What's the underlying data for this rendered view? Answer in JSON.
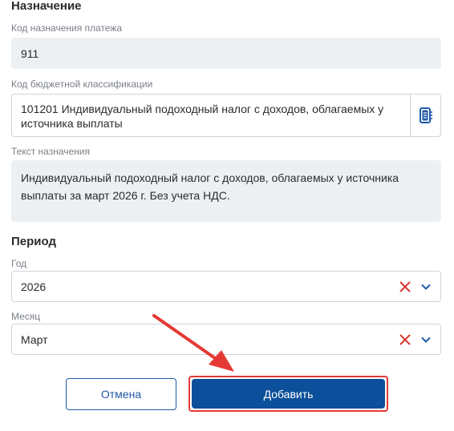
{
  "purpose_section": {
    "title": "Назначение",
    "payment_code": {
      "label": "Код назначения платежа",
      "value": "911"
    },
    "budget_code": {
      "label": "Код бюджетной классификации",
      "value": "101201 Индивидуальный подоходный налог с доходов, облагаемых у источника выплаты"
    },
    "purpose_text": {
      "label": "Текст назначения",
      "value": "Индивидуальный подоходный налог с доходов, облагаемых у источника выплаты за март 2026 г. Без учета НДС."
    }
  },
  "period_section": {
    "title": "Период",
    "year": {
      "label": "Год",
      "value": "2026"
    },
    "month": {
      "label": "Месяц",
      "value": "Март"
    }
  },
  "actions": {
    "cancel_label": "Отмена",
    "add_label": "Добавить"
  },
  "icons": {
    "catalog": "book-icon",
    "clear": "close-icon",
    "dropdown": "chevron-down-icon",
    "annotation": "arrow-icon"
  },
  "colors": {
    "primary": "#0c4f9a",
    "clear_red": "#d9342b",
    "annotation_red": "#e53935",
    "readonly_bg": "#edf0f3"
  }
}
